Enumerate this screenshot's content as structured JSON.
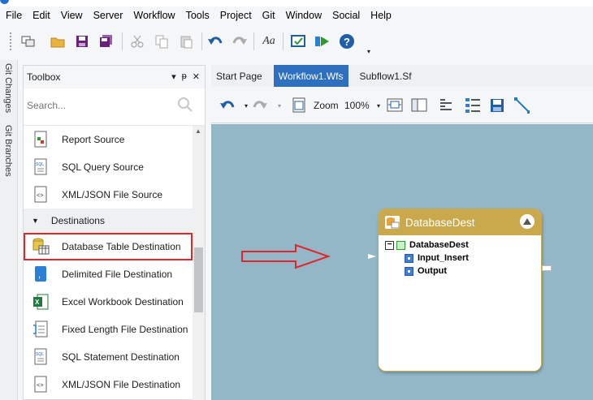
{
  "menu": [
    "File",
    "Edit",
    "View",
    "Server",
    "Workflow",
    "Tools",
    "Project",
    "Git",
    "Window",
    "Social",
    "Help"
  ],
  "left_strip": {
    "git_changes": "Git Changes",
    "git_branches": "Git Branches"
  },
  "toolbox": {
    "title": "Toolbox",
    "search_placeholder": "Search...",
    "items_top": [
      {
        "label": "Report Source",
        "icon": "report-icon"
      },
      {
        "label": "SQL Query Source",
        "icon": "sql-icon"
      },
      {
        "label": "XML/JSON File Source",
        "icon": "xml-icon"
      }
    ],
    "group": "Destinations",
    "items_dest": [
      {
        "label": "Database Table Destination",
        "icon": "database-table-icon"
      },
      {
        "label": "Delimited File Destination",
        "icon": "delimited-file-icon"
      },
      {
        "label": "Excel Workbook Destination",
        "icon": "excel-icon"
      },
      {
        "label": "Fixed Length File Destination",
        "icon": "fixed-length-icon"
      },
      {
        "label": "SQL Statement Destination",
        "icon": "sql-icon"
      },
      {
        "label": "XML/JSON File Destination",
        "icon": "xml-icon"
      }
    ]
  },
  "tabs": [
    {
      "label": "Start Page",
      "active": false
    },
    {
      "label": "Workflow1.Wfs",
      "active": true
    },
    {
      "label": "Subflow1.Sf",
      "active": false
    }
  ],
  "designer": {
    "zoom_label": "Zoom",
    "zoom_value": "100%"
  },
  "node": {
    "title": "DatabaseDest",
    "tree_root": "DatabaseDest",
    "ports": [
      "Input_Insert",
      "Output"
    ]
  },
  "colors": {
    "accent_tab": "#2f6fbf",
    "canvas": "#93b7c6",
    "node_header": "#c9a94b",
    "highlight": "#e0262b"
  }
}
